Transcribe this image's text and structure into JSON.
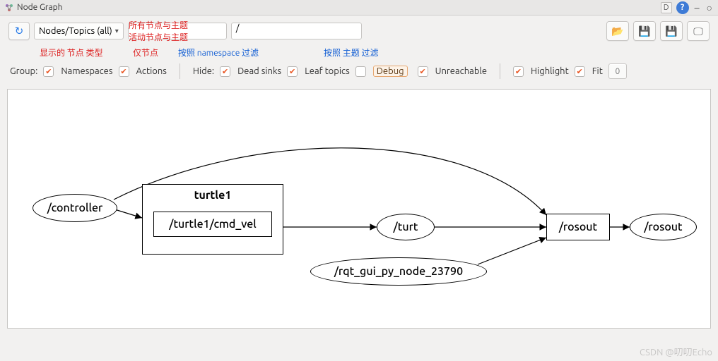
{
  "titlebar": {
    "title": "Node Graph",
    "d": "D",
    "help": "?",
    "min": "–",
    "max": "○"
  },
  "toolbar": {
    "combo_label": "Nodes/Topics (all)",
    "ns_filter_value": "",
    "topic_filter_value": "/",
    "annotations": {
      "show_types": "显示的 节点 类型",
      "all_nodes_topics": "所有节点与主题",
      "active_nodes_topics": "活动节点与主题",
      "only_nodes": "仅节点",
      "filter_by_ns": "按照 namespace 过滤",
      "filter_by_topic": "按照 主题 过滤"
    }
  },
  "toolbar2": {
    "group": "Group:",
    "namespaces": "Namespaces",
    "actions": "Actions",
    "hide": "Hide:",
    "dead_sinks": "Dead sinks",
    "leaf_topics": "Leaf topics",
    "debug": "Debug",
    "unreachable": "Unreachable",
    "highlight": "Highlight",
    "fit": "Fit",
    "num": "0"
  },
  "graph": {
    "controller": "/controller",
    "turtle1_group": "turtle1",
    "cmd_vel": "/turtle1/cmd_vel",
    "turt": "/turt",
    "rqt_node": "/rqt_gui_py_node_23790",
    "rosout_box": "/rosout",
    "rosout_ellipse": "/rosout"
  },
  "watermark": "CSDN @叨叨Echo"
}
